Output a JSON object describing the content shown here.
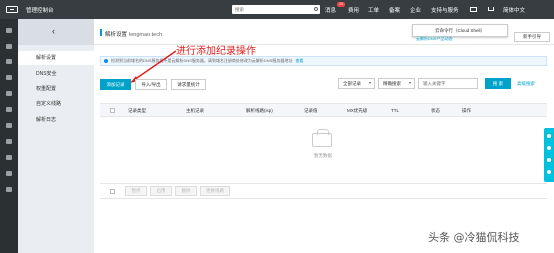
{
  "topbar": {
    "brand": "管理控制台",
    "search_placeholder": "搜索",
    "nav": [
      "消息",
      "费用",
      "工单",
      "备案",
      "企业",
      "支持与服务",
      "简体中文"
    ],
    "message_badge": "19"
  },
  "subnav": {
    "items": [
      "解析设置",
      "DNS安全",
      "权重配置",
      "自定义线路",
      "解析日志"
    ]
  },
  "header": {
    "title": "解析设置",
    "domain": "lengmao.tech",
    "cloudshell_tip": "云命令行（Cloud Shell）",
    "cloudshell_link": "云解析DNS产品动态",
    "refresh_label": "新手引导"
  },
  "notice": {
    "text": "检测到当前域名的DNS服务器不是云解析DNS服务器，请到域名注册商处修改为云解析DNS服务器地址",
    "link": "查看"
  },
  "toolbar": {
    "add_record": "添加记录",
    "import_export": "导入/导出",
    "request_stats": "请求量统计",
    "record_filter": "全部记录",
    "search_mode": "精确搜索",
    "keyword_placeholder": "输入关键字",
    "search_button": "搜 索",
    "advanced_search": "高级搜索"
  },
  "table": {
    "headers": [
      "记录类型",
      "主机记录",
      "解析线路(isp)",
      "记录值",
      "MX优先级",
      "TTL",
      "状态",
      "操作"
    ],
    "empty_text": "暂无数据"
  },
  "footer_actions": [
    "暂停",
    "启用",
    "删除",
    "更换线路"
  ],
  "annotation": {
    "text": "进行添加纪录操作",
    "color": "#e02020"
  },
  "watermark": "头条 @冷猫侃科技",
  "colors": {
    "topbar": "#373d41",
    "accent": "#00a2ca",
    "sidebar": "#eaedf1",
    "float_tab": "#00c1de"
  }
}
